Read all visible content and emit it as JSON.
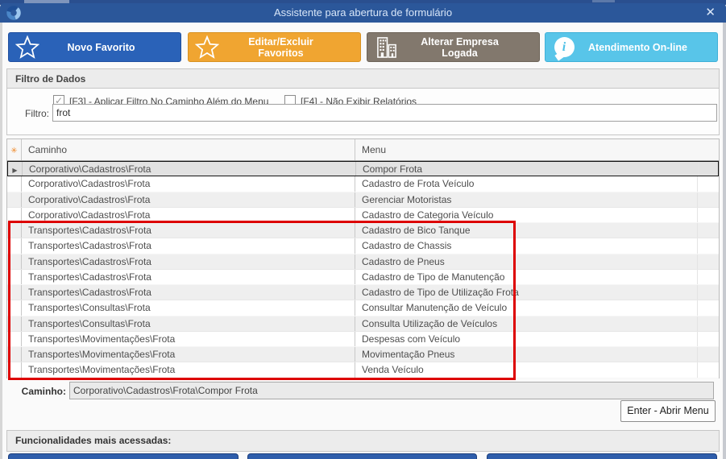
{
  "window": {
    "title": "Assistente para abertura de formulário"
  },
  "icons": {
    "close": "✕",
    "check": "✓",
    "row_indicator": "▶",
    "asterisk": "✳",
    "info": "i"
  },
  "toolbar": {
    "buttons": [
      {
        "label": "Novo Favorito",
        "color": "#2a62b8",
        "border": "#1f4fa0",
        "icon": "star-icon"
      },
      {
        "label": "Editar/Excluir Favoritos",
        "color": "#f0a531",
        "border": "#d89222",
        "icon": "star-icon"
      },
      {
        "label": "Alterar Empresa Logada",
        "color": "#82786d",
        "border": "#6d6459",
        "icon": "buildings-icon"
      },
      {
        "label": "Atendimento On-line",
        "color": "#58c5e9",
        "border": "#3fb0d8",
        "icon": "info-icon"
      }
    ]
  },
  "filter": {
    "section_title": "Filtro de Dados",
    "f3_label": "[F3] - Aplicar Filtro No Caminho Além do Menu",
    "f3_checked": true,
    "f4_label": "[F4] - Não Exibir Relatórios",
    "f4_checked": false,
    "input_label": "Filtro:",
    "input_value": "frot"
  },
  "table": {
    "columns": {
      "caminho": "Caminho",
      "menu": "Menu"
    },
    "selected_indicator": "▶",
    "rows": [
      {
        "caminho": "Corporativo\\Cadastros\\Frota",
        "menu": "Compor Frota",
        "selected": true
      },
      {
        "caminho": "Corporativo\\Cadastros\\Frota",
        "menu": "Cadastro de Frota Veículo"
      },
      {
        "caminho": "Corporativo\\Cadastros\\Frota",
        "menu": "Gerenciar Motoristas"
      },
      {
        "caminho": "Corporativo\\Cadastros\\Frota",
        "menu": "Cadastro de Categoria Veículo"
      },
      {
        "caminho": "Transportes\\Cadastros\\Frota",
        "menu": "Cadastro de Bico Tanque"
      },
      {
        "caminho": "Transportes\\Cadastros\\Frota",
        "menu": "Cadastro de Chassis"
      },
      {
        "caminho": "Transportes\\Cadastros\\Frota",
        "menu": "Cadastro de Pneus"
      },
      {
        "caminho": "Transportes\\Cadastros\\Frota",
        "menu": "Cadastro de Tipo de Manutenção"
      },
      {
        "caminho": "Transportes\\Cadastros\\Frota",
        "menu": "Cadastro de Tipo de Utilização Frota"
      },
      {
        "caminho": "Transportes\\Consultas\\Frota",
        "menu": "Consultar Manutenção de Veículo"
      },
      {
        "caminho": "Transportes\\Consultas\\Frota",
        "menu": "Consulta Utilização de Veículos"
      },
      {
        "caminho": "Transportes\\Movimentações\\Frota",
        "menu": "Despesas com Veículo"
      },
      {
        "caminho": "Transportes\\Movimentações\\Frota",
        "menu": "Movimentação Pneus"
      },
      {
        "caminho": "Transportes\\Movimentações\\Frota",
        "menu": "Venda Veículo"
      }
    ]
  },
  "path_bar": {
    "label": "Caminho:",
    "value": "Corporativo\\Cadastros\\Frota\\Compor Frota"
  },
  "open_button_label": "Enter - Abrir Menu",
  "footer": {
    "title": "Funcionalidades mais acessadas:"
  },
  "annotation_color": "#dd0000"
}
